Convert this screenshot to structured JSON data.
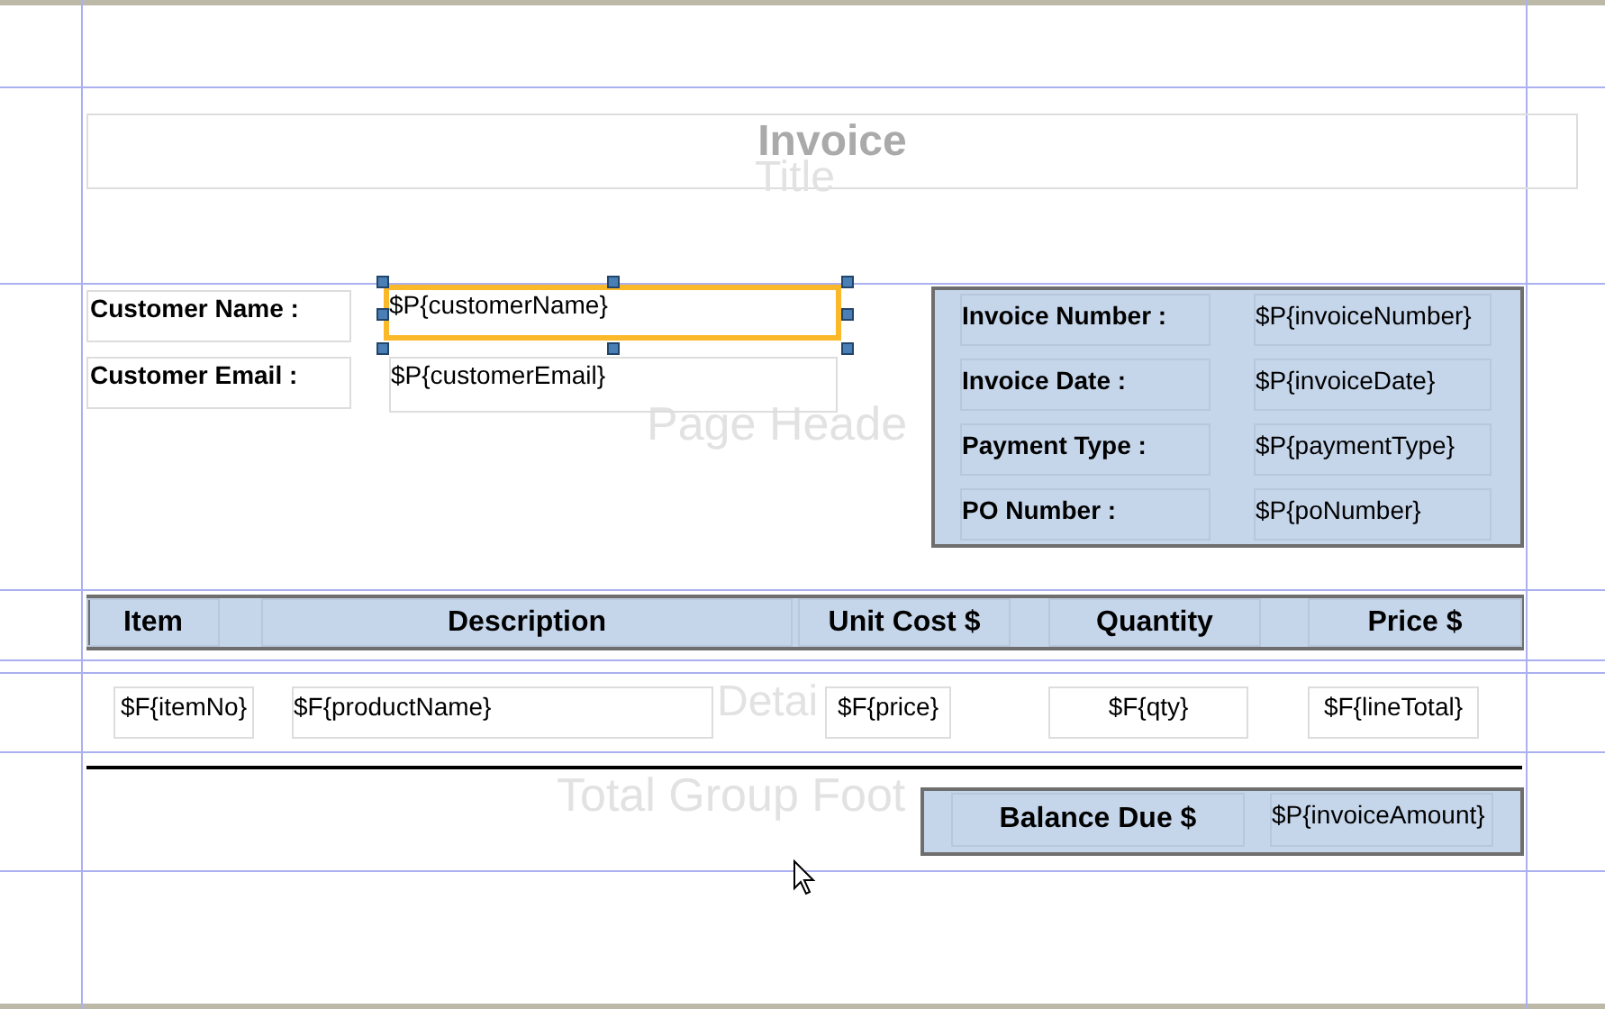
{
  "bands": [
    {
      "label": "Title"
    },
    {
      "label": "Page Heade"
    },
    {
      "label": "Detai"
    },
    {
      "label": "Total Group Foot"
    }
  ],
  "title": "Invoice",
  "customer_fields": [
    {
      "label": "Customer Name :",
      "value": "$P{customerName}",
      "selected": true
    },
    {
      "label": "Customer Email :",
      "value": "$P{customerEmail}",
      "selected": false
    }
  ],
  "invoice_info": [
    {
      "label": "Invoice Number :",
      "value": "$P{invoiceNumber}"
    },
    {
      "label": "Invoice Date :",
      "value": "$P{invoiceDate}"
    },
    {
      "label": "Payment Type :",
      "value": "$P{paymentType}"
    },
    {
      "label": "PO Number :",
      "value": "$P{poNumber}"
    }
  ],
  "table": {
    "columns": [
      "Item",
      "Description",
      "Unit Cost $",
      "Quantity",
      "Price $"
    ],
    "detail_fields": [
      "$F{itemNo}",
      "$F{productName}",
      "$F{price}",
      "$F{qty}",
      "$F{lineTotal}"
    ]
  },
  "balance": {
    "label": "Balance Due $",
    "value": "$P{invoiceAmount}"
  }
}
